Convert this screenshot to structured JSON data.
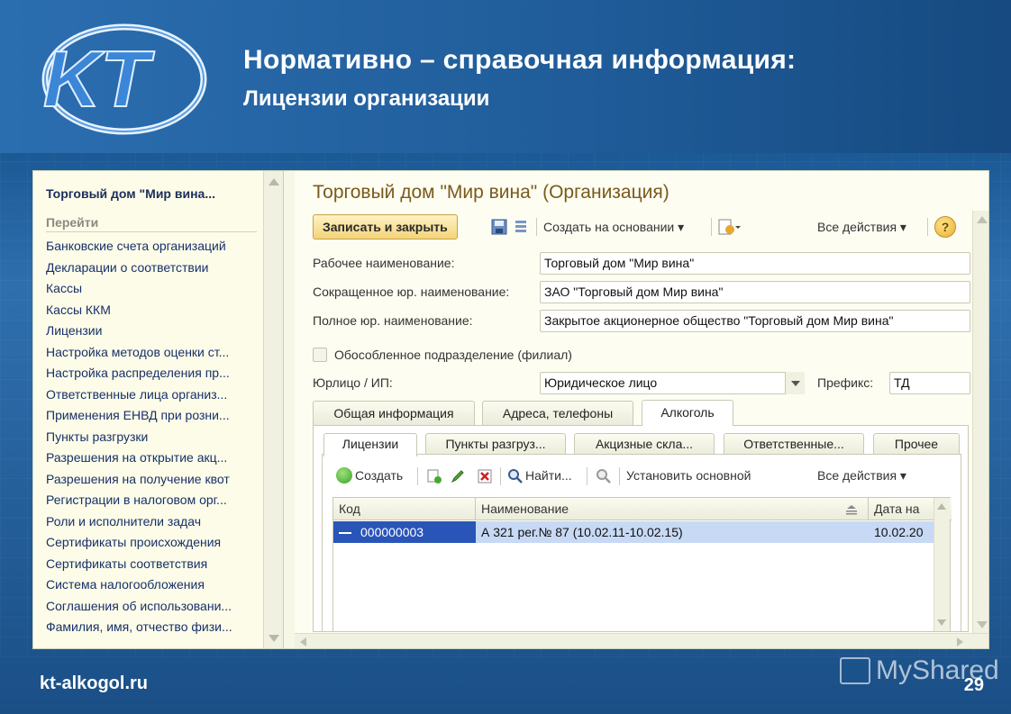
{
  "slide": {
    "title": "Нормативно – справочная информация:",
    "subtitle": "Лицензии организации",
    "site": "kt-alkogol.ru",
    "page_number": "29",
    "watermark": "MyShared",
    "logo_text": "KT"
  },
  "nav": {
    "header": "Торговый дом \"Мир вина...",
    "goto_label": "Перейти",
    "items": [
      "Банковские счета организаций",
      "Декларации о соответствии",
      "Кассы",
      "Кассы ККМ",
      "Лицензии",
      "Настройка методов оценки ст...",
      "Настройка распределения пр...",
      "Ответственные лица организ...",
      "Применения ЕНВД при розни...",
      "Пункты разгрузки",
      "Разрешения на открытие акц...",
      "Разрешения на получение квот",
      "Регистрации в налоговом орг...",
      "Роли и исполнители задач",
      "Сертификаты происхождения",
      "Сертификаты соответствия",
      "Система налогообложения",
      "Соглашения об использовани...",
      "Фамилия, имя, отчество физи..."
    ]
  },
  "form": {
    "title": "Торговый дом \"Мир вина\" (Организация)",
    "toolbar": {
      "save_close": "Записать и закрыть",
      "create_based": "Создать на основании",
      "all_actions": "Все действия",
      "help": "?"
    },
    "fields": {
      "work_name_label": "Рабочее наименование:",
      "work_name_value": "Торговый дом \"Мир вина\"",
      "short_name_label": "Сокращенное юр. наименование:",
      "short_name_value": "ЗАО \"Торговый дом Мир вина\"",
      "full_name_label": "Полное юр. наименование:",
      "full_name_value": "Закрытое акционерное общество \"Торговый дом Мир вина\"",
      "branch_label": "Обособленное подразделение (филиал)",
      "entity_label": "Юрлицо / ИП:",
      "entity_value": "Юридическое лицо",
      "prefix_label": "Префикс:",
      "prefix_value": "ТД"
    },
    "tabs": [
      "Общая информация",
      "Адреса, телефоны",
      "Алкоголь"
    ],
    "inner_tabs": [
      "Лицензии",
      "Пункты разгруз...",
      "Акцизные скла...",
      "Ответственные...",
      "Прочее"
    ],
    "inner_toolbar": {
      "create": "Создать",
      "find": "Найти...",
      "set_main": "Установить основной",
      "all_actions": "Все действия"
    },
    "table": {
      "columns": [
        "Код",
        "Наименование",
        "Дата на"
      ],
      "rows": [
        {
          "code": "000000003",
          "name": "А 321 рег.№ 87 (10.02.11-10.02.15)",
          "date": "10.02.20"
        }
      ]
    }
  },
  "colors": {
    "slide_bg": "#1d4f82",
    "form_title": "#7a5a1a",
    "nav_link": "#18306a",
    "selection": "#2a55b8"
  }
}
